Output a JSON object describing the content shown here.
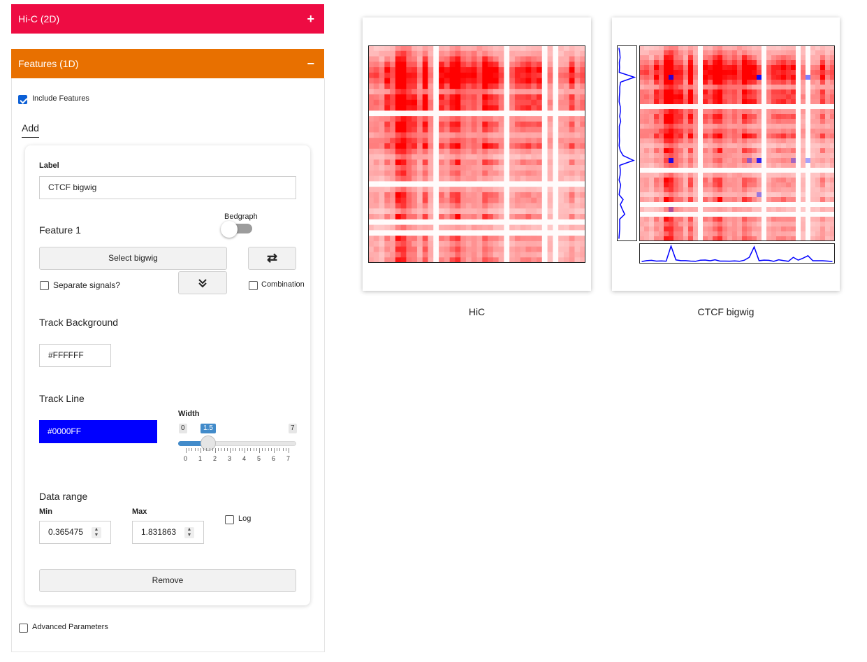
{
  "hic_section": {
    "title": "Hi-C (2D)",
    "toggle": "+"
  },
  "features_section": {
    "title": "Features (1D)",
    "toggle": "−",
    "include_features_label": "Include Features",
    "tab_add": "Add",
    "card": {
      "label_caption": "Label",
      "label_value": "CTCF bigwig",
      "feature_title": "Feature 1",
      "bedgraph_label": "Bedgraph",
      "select_bigwig": "Select bigwig",
      "swap_icon": "⇄",
      "separate_signals": "Separate signals?",
      "expand_icon": "chevron-double-down",
      "combination": "Combination",
      "track_background_title": "Track Background",
      "track_background_value": "#FFFFFF",
      "track_line_title": "Track Line",
      "track_line_value": "#0000FF",
      "track_line_color": "#0000ff",
      "width_label": "Width",
      "width_min": "0",
      "width_value": "1.5",
      "width_max": "7",
      "width_ticks": [
        "0",
        "1",
        "2",
        "3",
        "4",
        "5",
        "6",
        "7"
      ],
      "data_range_title": "Data range",
      "min_label": "Min",
      "min_value": "0.365475",
      "max_label": "Max",
      "max_value": "1.831863",
      "log_label": "Log",
      "remove_button": "Remove"
    },
    "advanced_parameters": "Advanced Parameters"
  },
  "plots": [
    {
      "caption": "HiC"
    },
    {
      "caption": "CTCF bigwig"
    }
  ],
  "colors": {
    "hic_header": "#ee0c43",
    "features_header": "#e87000",
    "heatmap": "#ff0000",
    "track": "#0000ff"
  }
}
